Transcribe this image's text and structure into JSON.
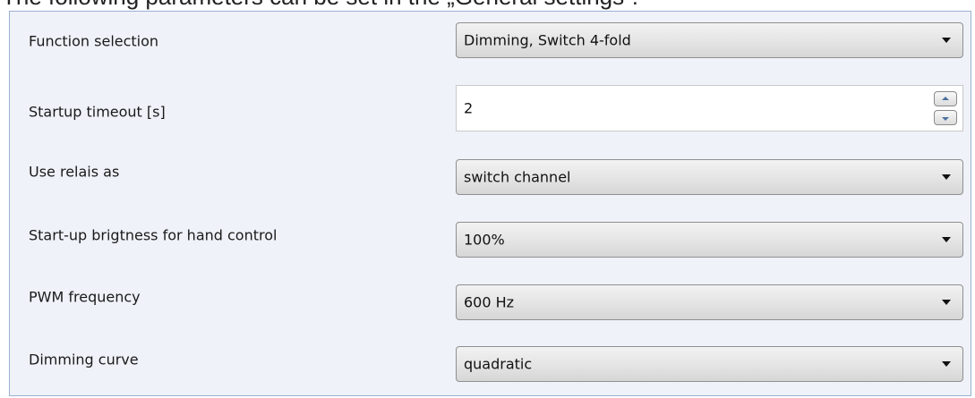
{
  "cutoff_text": "The following parameters can be set in the „General settings“:",
  "rows": [
    {
      "label": "Function selection",
      "control": "dropdown",
      "value": "Dimming, Switch 4-fold"
    },
    {
      "label": "Startup timeout [s]",
      "control": "spinbox",
      "value": "2"
    },
    {
      "label": "Use relais as",
      "control": "dropdown",
      "value": "switch channel"
    },
    {
      "label": "Start-up brigtness for hand control",
      "control": "dropdown",
      "value": "100%"
    },
    {
      "label": "PWM frequency",
      "control": "dropdown",
      "value": "600 Hz"
    },
    {
      "label": "Dimming curve",
      "control": "dropdown",
      "value": "quadratic"
    }
  ],
  "icons": {
    "dropdown_arrow": "chevron-down-icon",
    "spin_up": "spin-up-icon",
    "spin_down": "spin-down-icon"
  },
  "colors": {
    "panel_background": "#eff2f9",
    "panel_border": "#9cb0d2",
    "spin_arrow": "#4a6fa0"
  }
}
